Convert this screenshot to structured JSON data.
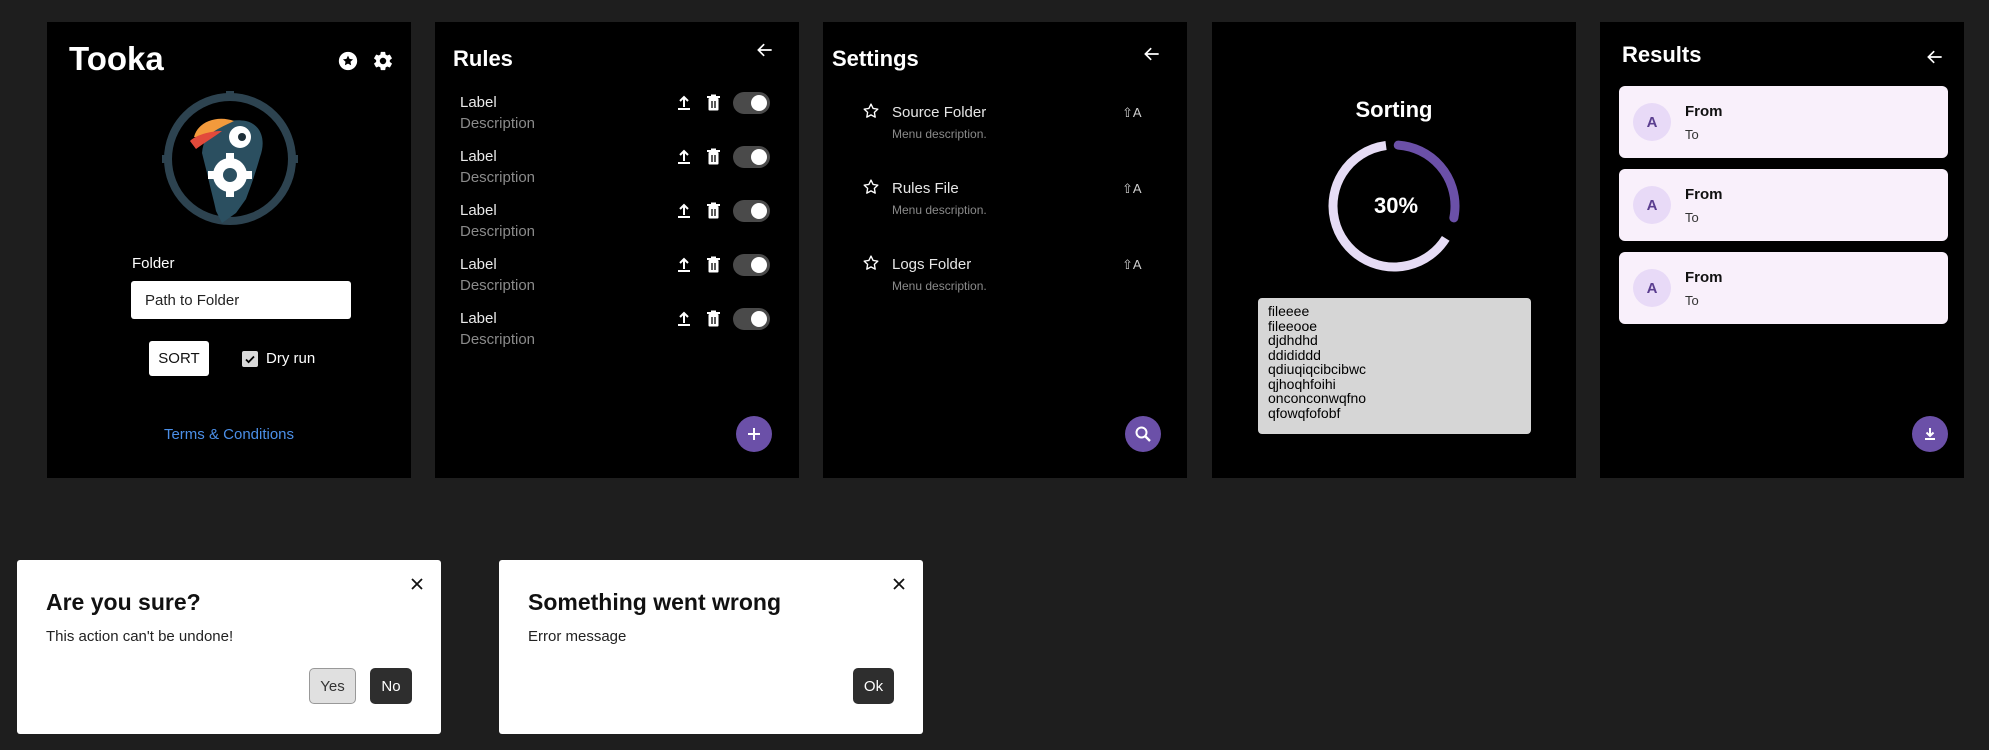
{
  "home": {
    "title": "Tooka",
    "folder_label": "Folder",
    "folder_value": "Path to Folder",
    "sort_label": "SORT",
    "dry_run_label": "Dry run",
    "dry_run_checked": true,
    "terms_label": "Terms & Conditions",
    "icons": [
      "star-badge-icon",
      "gear-icon"
    ]
  },
  "rules": {
    "title": "Rules",
    "items": [
      {
        "label": "Label",
        "description": "Description",
        "enabled": true
      },
      {
        "label": "Label",
        "description": "Description",
        "enabled": true
      },
      {
        "label": "Label",
        "description": "Description",
        "enabled": true
      },
      {
        "label": "Label",
        "description": "Description",
        "enabled": true
      },
      {
        "label": "Label",
        "description": "Description",
        "enabled": true
      }
    ]
  },
  "settings": {
    "title": "Settings",
    "items": [
      {
        "name": "Source Folder",
        "description": "Menu description.",
        "shortcut": "⇧A"
      },
      {
        "name": "Rules File",
        "description": "Menu description.",
        "shortcut": "⇧A"
      },
      {
        "name": "Logs Folder",
        "description": "Menu description.",
        "shortcut": "⇧A"
      }
    ]
  },
  "sorting": {
    "title": "Sorting",
    "progress": 0.3,
    "progress_label": "30%",
    "log_lines": [
      "fileeee",
      "fileeooe",
      "djdhdhd",
      "ddididdd",
      "qdiuqiqcibcibwc",
      "qjhoqhfoihi",
      "onconconwqfno",
      "qfowqfofobf"
    ]
  },
  "results": {
    "title": "Results",
    "items": [
      {
        "avatar": "A",
        "from": "From",
        "to": "To"
      },
      {
        "avatar": "A",
        "from": "From",
        "to": "To"
      },
      {
        "avatar": "A",
        "from": "From",
        "to": "To"
      }
    ]
  },
  "confirm_dialog": {
    "title": "Are you sure?",
    "message": "This action can't be undone!",
    "yes_label": "Yes",
    "no_label": "No"
  },
  "error_dialog": {
    "title": "Something went wrong",
    "message": "Error message",
    "ok_label": "Ok"
  },
  "colors": {
    "accent": "#6b50a8",
    "progress_track": "#e6dcf5",
    "link": "#4b8fe8",
    "card_bg": "#f9f0fb"
  }
}
